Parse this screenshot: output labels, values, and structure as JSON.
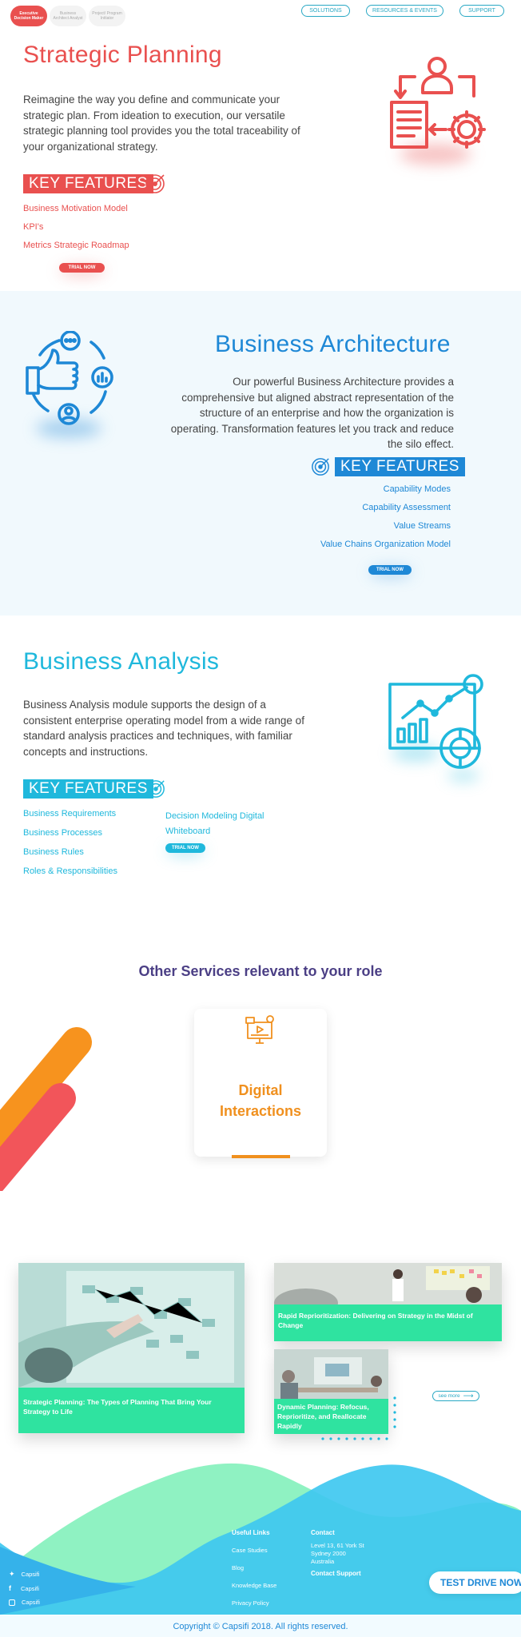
{
  "topnav": {
    "tabs": [
      {
        "label": "Executive Decision Maker",
        "active": true
      },
      {
        "label": "Business Architect Analyst",
        "active": false
      },
      {
        "label": "Project/ Program Initiator",
        "active": false
      }
    ],
    "links": [
      "SOLUTIONS",
      "RESOURCES & EVENTS",
      "SUPPORT"
    ]
  },
  "strategic": {
    "title": "Strategic Planning",
    "description": "Reimagine the way you define and communicate your strategic plan. From ideation to execution, our versatile strategic planning tool provides you the total traceability of your organizational strategy.",
    "key_features_label": "KEY FEATURES",
    "features": [
      "Business Motivation Model",
      "KPI's",
      "Metrics Strategic Roadmap"
    ],
    "trial_label": "TRIAL NOW",
    "accent": "#e9504f",
    "icon": "person-document-gear-icon"
  },
  "architecture": {
    "title": "Business Architecture",
    "description": "Our powerful Business Architecture provides a comprehensive but aligned abstract representation of the structure of an enterprise and how the organization is operating. Transformation features let you track and reduce the silo effect.",
    "key_features_label": "KEY FEATURES",
    "features": [
      "Capability Modes",
      "Capability Assessment",
      "Value Streams",
      "Value Chains Organization Model"
    ],
    "trial_label": "TRIAL NOW",
    "accent": "#1e88d6",
    "icon": "thumbs-up-cycle-icon"
  },
  "analysis": {
    "title": "Business Analysis",
    "description": "Business Analysis module supports the design of a consistent enterprise operating model from a wide range of standard analysis practices and techniques, with familiar concepts and instructions.",
    "key_features_label": "KEY FEATURES",
    "features_left": [
      "Business Requirements",
      "Business Processes",
      "Business Rules",
      "Roles & Responsibilities"
    ],
    "features_right": [
      "Decision Modeling Digital Whiteboard"
    ],
    "trial_label": "TRIAL NOW",
    "accent": "#1fb8dc",
    "icon": "analytics-board-icon"
  },
  "other_services": {
    "heading": "Other Services relevant to your role",
    "card": {
      "title": "Digital Interactions",
      "icon": "digital-interaction-icon",
      "accent": "#f0901e"
    }
  },
  "blog": {
    "cards": [
      {
        "title": "Strategic Planning: The Types of Planning That Bring Your Strategy to Life"
      },
      {
        "title": "Rapid Reprioritization: Delivering on Strategy in the Midst of Change"
      },
      {
        "title": "Dynamic Planning: Refocus, Reprioritize, and Reallocate Rapidly"
      }
    ],
    "see_more_label": "see more"
  },
  "footer": {
    "social": [
      "Capsifi",
      "Capsifi",
      "Capsifi"
    ],
    "useful_links_heading": "Useful Links",
    "useful_links": [
      "Case Studies",
      "Blog",
      "Knowledge Base",
      "Privacy Policy"
    ],
    "contact_heading": "Contact",
    "address": [
      "Level 13, 61 York St",
      "Sydney 2000",
      "Australia"
    ],
    "contact_support": "Contact Support",
    "test_drive_label": "TEST DRIVE NOW",
    "copyright": "Copyright © Capsifi 2018. All rights reserved."
  }
}
